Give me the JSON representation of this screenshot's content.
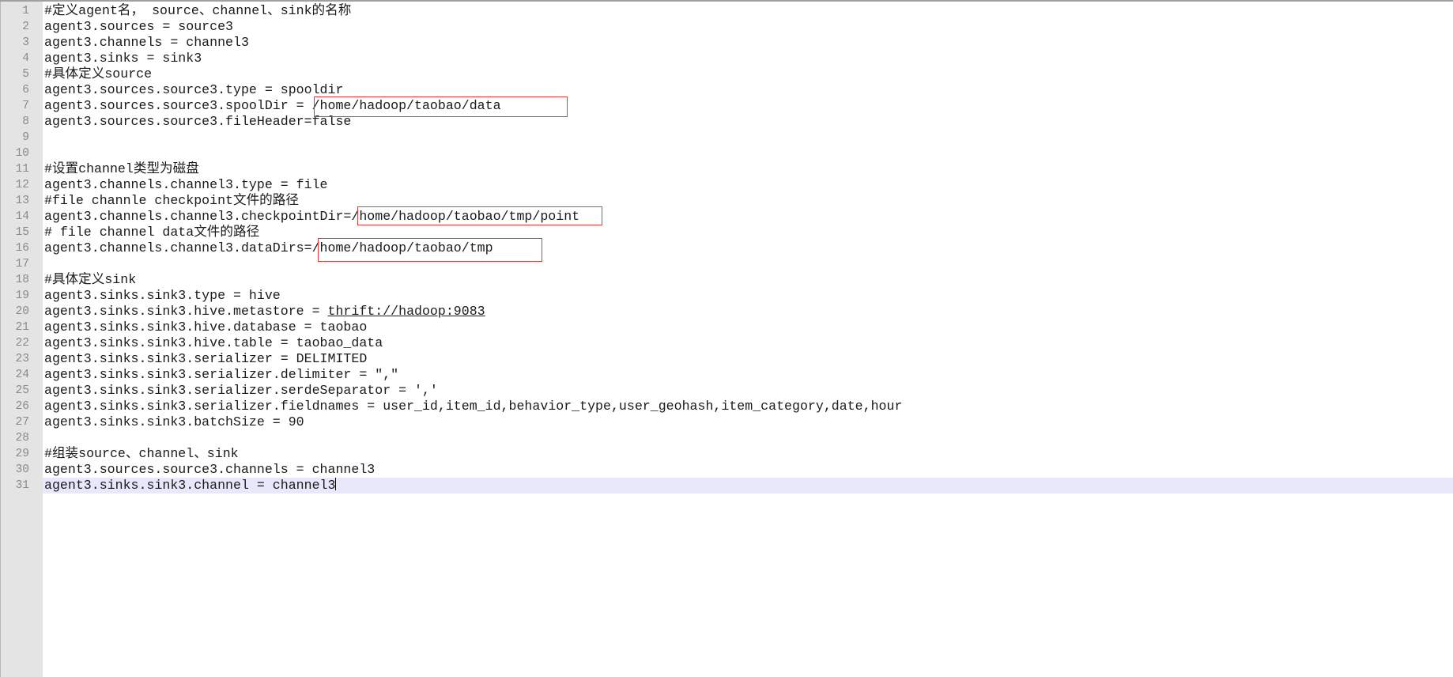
{
  "editor": {
    "highlight_color": "#e33a3a",
    "current_line_color": "#e8e8fb",
    "gutter_color": "#e4e4e4",
    "current_line_number": 31,
    "lines": [
      {
        "num": "1",
        "text": "#定义agent名， source、channel、sink的名称"
      },
      {
        "num": "2",
        "text": "agent3.sources = source3"
      },
      {
        "num": "3",
        "text": "agent3.channels = channel3"
      },
      {
        "num": "4",
        "text": "agent3.sinks = sink3"
      },
      {
        "num": "5",
        "text": "#具体定义source"
      },
      {
        "num": "6",
        "text": "agent3.sources.source3.type = spooldir"
      },
      {
        "num": "7",
        "text": "agent3.sources.source3.spoolDir = /home/hadoop/taobao/data"
      },
      {
        "num": "8",
        "text": "agent3.sources.source3.fileHeader=false"
      },
      {
        "num": "9",
        "text": ""
      },
      {
        "num": "10",
        "text": ""
      },
      {
        "num": "11",
        "text": "#设置channel类型为磁盘"
      },
      {
        "num": "12",
        "text": "agent3.channels.channel3.type = file"
      },
      {
        "num": "13",
        "text": "#file channle checkpoint文件的路径"
      },
      {
        "num": "14",
        "text": "agent3.channels.channel3.checkpointDir=/home/hadoop/taobao/tmp/point"
      },
      {
        "num": "15",
        "text": "# file channel data文件的路径"
      },
      {
        "num": "16",
        "text": "agent3.channels.channel3.dataDirs=/home/hadoop/taobao/tmp"
      },
      {
        "num": "17",
        "text": ""
      },
      {
        "num": "18",
        "text": "#具体定义sink"
      },
      {
        "num": "19",
        "text": "agent3.sinks.sink3.type = hive"
      },
      {
        "num": "20",
        "text_before": "agent3.sinks.sink3.hive.metastore = ",
        "link": "thrift://hadoop:9083"
      },
      {
        "num": "21",
        "text": "agent3.sinks.sink3.hive.database = taobao"
      },
      {
        "num": "22",
        "text": "agent3.sinks.sink3.hive.table = taobao_data"
      },
      {
        "num": "23",
        "text": "agent3.sinks.sink3.serializer = DELIMITED"
      },
      {
        "num": "24",
        "text": "agent3.sinks.sink3.serializer.delimiter = \",\""
      },
      {
        "num": "25",
        "text": "agent3.sinks.sink3.serializer.serdeSeparator = ','"
      },
      {
        "num": "26",
        "text": "agent3.sinks.sink3.serializer.fieldnames = user_id,item_id,behavior_type,user_geohash,item_category,date,hour"
      },
      {
        "num": "27",
        "text": "agent3.sinks.sink3.batchSize = 90"
      },
      {
        "num": "28",
        "text": ""
      },
      {
        "num": "29",
        "text": "#组装source、channel、sink"
      },
      {
        "num": "30",
        "text": "agent3.sources.source3.channels = channel3"
      },
      {
        "num": "31",
        "text": "agent3.sinks.sink3.channel = channel3"
      }
    ]
  }
}
